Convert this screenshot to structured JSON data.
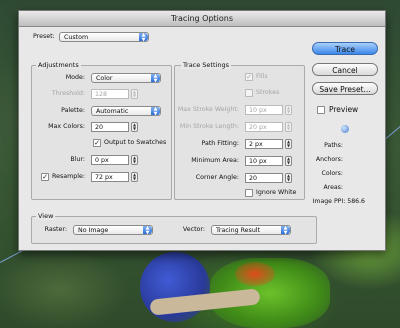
{
  "dialog": {
    "title": "Tracing Options"
  },
  "preset": {
    "label": "Preset:",
    "value": "Custom"
  },
  "adjustments": {
    "title": "Adjustments",
    "mode": {
      "label": "Mode:",
      "value": "Color"
    },
    "threshold": {
      "label": "Threshold:",
      "value": "128"
    },
    "palette": {
      "label": "Palette:",
      "value": "Automatic"
    },
    "max_colors": {
      "label": "Max Colors:",
      "value": "20"
    },
    "output_to_swatches": {
      "label": "Output to Swatches",
      "checked": true
    },
    "blur": {
      "label": "Blur:",
      "value": "0 px"
    },
    "resample": {
      "label": "Resample:",
      "value": "72 px",
      "checked": true
    }
  },
  "trace_settings": {
    "title": "Trace Settings",
    "fills": {
      "label": "Fills",
      "checked": true
    },
    "strokes": {
      "label": "Strokes",
      "checked": false
    },
    "max_stroke_weight": {
      "label": "Max Stroke Weight:",
      "value": "10 px"
    },
    "min_stroke_length": {
      "label": "Min Stroke Length:",
      "value": "20 px"
    },
    "path_fitting": {
      "label": "Path Fitting:",
      "value": "2 px"
    },
    "minimum_area": {
      "label": "Minimum Area:",
      "value": "10 px"
    },
    "corner_angle": {
      "label": "Corner Angle:",
      "value": "20"
    },
    "ignore_white": {
      "label": "Ignore White",
      "checked": false
    }
  },
  "view": {
    "title": "View",
    "raster": {
      "label": "Raster:",
      "value": "No Image"
    },
    "vector": {
      "label": "Vector:",
      "value": "Tracing Result"
    }
  },
  "buttons": {
    "trace": "Trace",
    "cancel": "Cancel",
    "save_preset": "Save Preset..."
  },
  "preview": {
    "label": "Preview",
    "checked": false
  },
  "stats": {
    "paths": "Paths:",
    "anchors": "Anchors:",
    "colors": "Colors:",
    "areas": "Areas:",
    "image_ppi": "Image PPI: 586.6"
  },
  "colors": {
    "accent": "#3b86e8"
  }
}
